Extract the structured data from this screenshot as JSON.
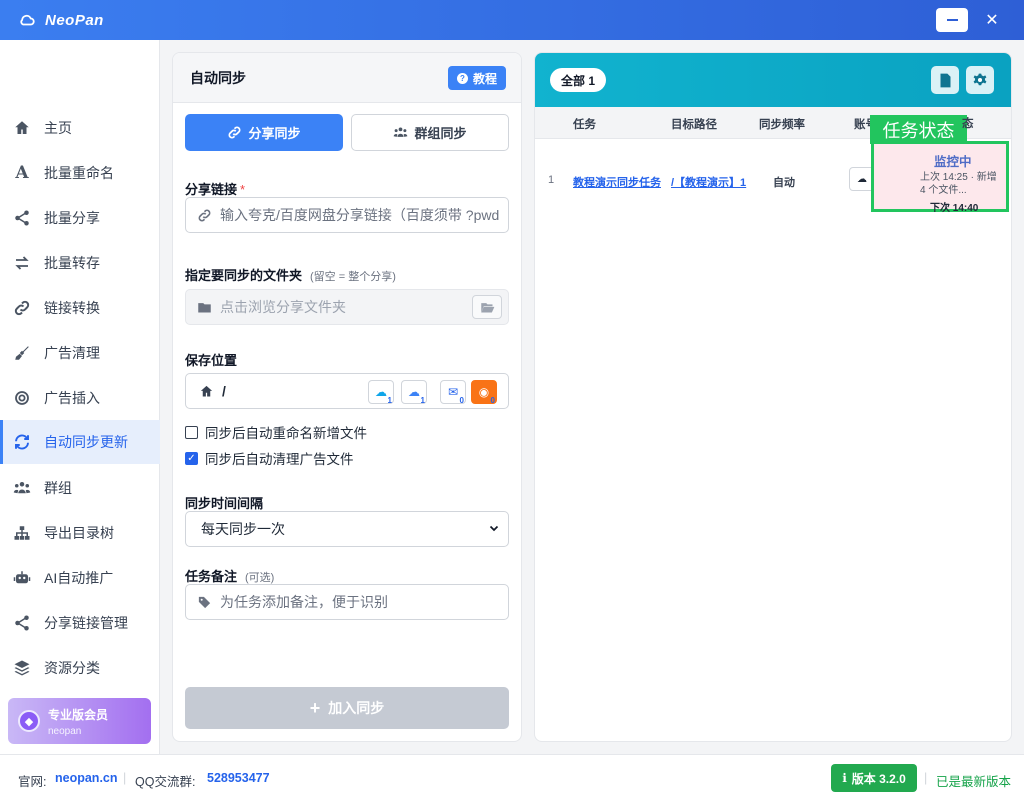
{
  "app": {
    "name": "NeoPan"
  },
  "sidebar": {
    "items": [
      {
        "label": "主页",
        "icon": "home-icon"
      },
      {
        "label": "批量重命名",
        "icon": "font-icon"
      },
      {
        "label": "批量分享",
        "icon": "share-icon"
      },
      {
        "label": "批量转存",
        "icon": "exchange-icon"
      },
      {
        "label": "链接转换",
        "icon": "link-icon"
      },
      {
        "label": "广告清理",
        "icon": "broom-icon"
      },
      {
        "label": "广告插入",
        "icon": "target-icon"
      },
      {
        "label": "自动同步更新",
        "icon": "sync-icon"
      },
      {
        "label": "群组",
        "icon": "group-icon"
      },
      {
        "label": "导出目录树",
        "icon": "sitemap-icon"
      },
      {
        "label": "AI自动推广",
        "icon": "robot-icon"
      },
      {
        "label": "分享链接管理",
        "icon": "share-icon"
      },
      {
        "label": "资源分类",
        "icon": "layers-icon"
      }
    ],
    "active_index": 7,
    "pro": {
      "title": "专业版会员",
      "user": "neopan"
    }
  },
  "form": {
    "title": "自动同步",
    "tutorial_label": "教程",
    "tabs": {
      "share": "分享同步",
      "group": "群组同步"
    },
    "share_link": {
      "label": "分享链接",
      "required_mark": "*",
      "placeholder": "输入夸克/百度网盘分享链接（百度须带 ?pwd"
    },
    "folder": {
      "label": "指定要同步的文件夹",
      "hint": "(留空 = 整个分享)",
      "placeholder": "点击浏览分享文件夹"
    },
    "save": {
      "label": "保存位置",
      "path": "/",
      "cloud_counts": [
        "1",
        "1",
        "0",
        "0"
      ]
    },
    "options": [
      {
        "label": "同步后自动重命名新增文件",
        "checked": false
      },
      {
        "label": "同步后自动清理广告文件",
        "checked": true
      }
    ],
    "interval": {
      "label": "同步时间间隔",
      "value": "每天同步一次"
    },
    "note": {
      "label": "任务备注",
      "hint": "(可选)",
      "placeholder": "为任务添加备注，便于识别"
    },
    "submit_label": "加入同步"
  },
  "tasks": {
    "filter_label": "全部 1",
    "columns": [
      "任务",
      "目标路径",
      "同步频率",
      "账号",
      "状态"
    ],
    "rows": [
      {
        "index": "1",
        "name": "教程演示同步任务",
        "path": "/【教程演示】1",
        "freq": "自动",
        "status_title": "任务状态",
        "status": "监控中",
        "last": "上次 14:25 · 新增 4 个文件...",
        "next": "下次 14:40"
      }
    ]
  },
  "footer": {
    "site_label": "官网:",
    "site": "neopan.cn",
    "qq_label": "QQ交流群:",
    "qq": "528953477",
    "version": "版本 3.2.0",
    "latest": "已是最新版本"
  },
  "colors": {
    "primary": "#3b82f6",
    "teal": "#11b3cf",
    "success": "#22c55e",
    "active_bg": "#e6eefc"
  }
}
